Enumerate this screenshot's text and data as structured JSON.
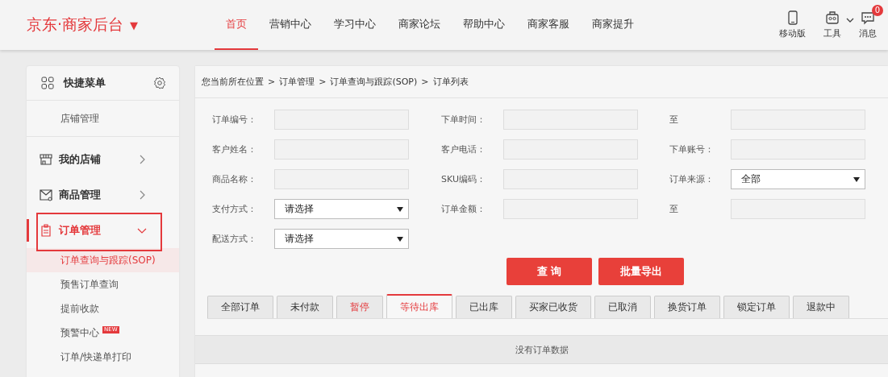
{
  "header": {
    "logo": "京东·商家后台",
    "logo_caret": "▼",
    "nav": [
      {
        "label": "首页",
        "selected": true
      },
      {
        "label": "营销中心",
        "selected": false
      },
      {
        "label": "学习中心",
        "selected": false
      },
      {
        "label": "商家论坛",
        "selected": false
      },
      {
        "label": "帮助中心",
        "selected": false
      },
      {
        "label": "商家客服",
        "selected": false
      },
      {
        "label": "商家提升",
        "selected": false
      }
    ],
    "tools": [
      {
        "kind": "phone",
        "label": "移动版"
      },
      {
        "kind": "toolbox",
        "label": "工具",
        "dropdown": true
      },
      {
        "kind": "message",
        "label": "消息",
        "badge": "0"
      }
    ]
  },
  "sidebar": {
    "quick_menu": {
      "title": "快捷菜单",
      "items": [
        "店铺管理"
      ]
    },
    "sections": [
      {
        "kind": "store",
        "label": "我的店铺",
        "expanded": false,
        "highlighted": false
      },
      {
        "kind": "goods",
        "label": "商品管理",
        "expanded": false,
        "highlighted": false
      },
      {
        "kind": "order",
        "label": "订单管理",
        "expanded": true,
        "highlighted": true,
        "children": [
          {
            "label": "订单查询与跟踪(SOP)",
            "selected": true
          },
          {
            "label": "预售订单查询",
            "selected": false
          },
          {
            "label": "提前收款",
            "selected": false
          },
          {
            "label": "预警中心",
            "selected": false,
            "badge": "NEW"
          },
          {
            "label": "订单/快递单打印",
            "selected": false
          }
        ]
      }
    ]
  },
  "breadcrumb": [
    "您当前所在位置",
    "订单管理",
    "订单查询与跟踪(SOP)",
    "订单列表"
  ],
  "breadcrumb_separator": ">",
  "form": {
    "rows": [
      [
        {
          "label": "订单编号：",
          "kind": "input"
        },
        {
          "label": "下单时间：",
          "kind": "input"
        },
        {
          "label": "至",
          "kind": "input"
        }
      ],
      [
        {
          "label": "客户姓名：",
          "kind": "input"
        },
        {
          "label": "客户电话：",
          "kind": "input"
        },
        {
          "label": "下单账号：",
          "kind": "input"
        }
      ],
      [
        {
          "label": "商品名称：",
          "kind": "input"
        },
        {
          "label": "SKU编码：",
          "kind": "input"
        },
        {
          "label": "订单来源：",
          "kind": "select",
          "value": "全部"
        }
      ],
      [
        {
          "label": "支付方式：",
          "kind": "select",
          "value": "请选择"
        },
        {
          "label": "订单金额：",
          "kind": "input"
        },
        {
          "label": "至",
          "kind": "input"
        }
      ],
      [
        {
          "label": "配送方式：",
          "kind": "select",
          "value": "请选择"
        }
      ]
    ],
    "buttons": [
      "查 询",
      "批量导出"
    ]
  },
  "order_tabs": [
    {
      "label": "全部订单",
      "selected": false,
      "alert": false
    },
    {
      "label": "未付款",
      "selected": false,
      "alert": false
    },
    {
      "label": "暂停",
      "selected": false,
      "alert": true
    },
    {
      "label": "等待出库",
      "selected": true,
      "alert": false
    },
    {
      "label": "已出库",
      "selected": false,
      "alert": false
    },
    {
      "label": "买家已收货",
      "selected": false,
      "alert": false
    },
    {
      "label": "已取消",
      "selected": false,
      "alert": false
    },
    {
      "label": "换货订单",
      "selected": false,
      "alert": false
    },
    {
      "label": "锁定订单",
      "selected": false,
      "alert": false
    },
    {
      "label": "退款中",
      "selected": false,
      "alert": false
    }
  ],
  "empty_message": "没有订单数据"
}
